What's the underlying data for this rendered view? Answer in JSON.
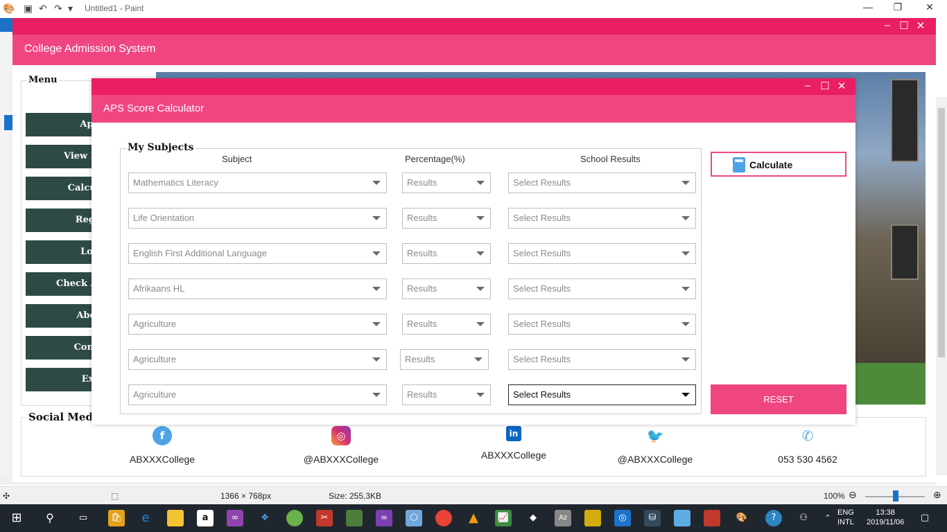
{
  "paint": {
    "title": "Untitled1 - Paint",
    "status": {
      "dimensions": "1366 × 768px",
      "size": "Size: 255,3KB",
      "zoom": "100%"
    }
  },
  "college": {
    "title": "College Admission System",
    "menu": {
      "legend": "Menu",
      "items": [
        "Appl",
        "View Progr",
        "Calculate",
        "Regist",
        "Logi",
        "Check Admiss",
        "About",
        "Contac",
        "Exit"
      ]
    },
    "social": {
      "legend": "Social Media",
      "items": [
        {
          "icon": "facebook-icon",
          "text": "ABXXXCollege",
          "color": "#4da3e6"
        },
        {
          "icon": "instagram-icon",
          "text": "@ABXXXCollege",
          "color": "#d6306e"
        },
        {
          "icon": "linkedin-icon",
          "text": "ABXXXCollege",
          "color": "#0a66c2"
        },
        {
          "icon": "twitter-icon",
          "text": "@ABXXXCollege",
          "color": "#1da1f2"
        },
        {
          "icon": "phone-icon",
          "text": "053 530 4562",
          "color": "#5aa9e6"
        }
      ]
    }
  },
  "aps": {
    "title": "APS Score Calculator",
    "group_legend": "My Subjects",
    "headers": {
      "subject": "Subject",
      "percentage": "Percentage(%)",
      "school_results": "School Results"
    },
    "rows": [
      {
        "subject": "Mathematics Literacy",
        "percentage": "Results",
        "school": "Select Results"
      },
      {
        "subject": "Life Orientation",
        "percentage": "Results",
        "school": "Select Results"
      },
      {
        "subject": "English First Additional Language",
        "percentage": "Results",
        "school": "Select Results"
      },
      {
        "subject": "Afrikaans HL",
        "percentage": "Results",
        "school": "Select Results"
      },
      {
        "subject": "Agriculture",
        "percentage": "Results",
        "school": "Select Results"
      },
      {
        "subject": "Agriculture",
        "percentage": "Results",
        "school": "Select Results"
      },
      {
        "subject": "Agriculture",
        "percentage": "Results",
        "school": "Select Results"
      }
    ],
    "calculate_label": "Calculate",
    "reset_label": "RESET",
    "accent": "#ef4682"
  },
  "taskbar": {
    "lang_top": "ENG",
    "lang_bottom": "INTL",
    "time": "13:38",
    "date": "2019/11/06"
  }
}
